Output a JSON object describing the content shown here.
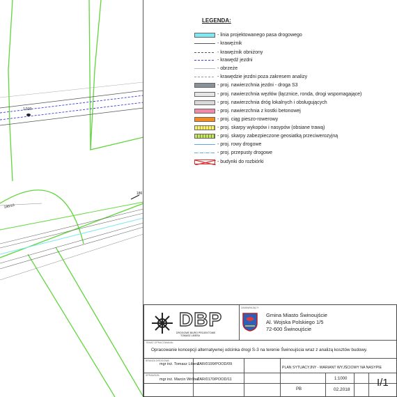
{
  "drawing": {
    "scale_label": "1:500",
    "label_a": "186/10",
    "label_b": "186"
  },
  "legend": {
    "title": "LEGENDA:",
    "items": [
      {
        "label": "- linia projektowanego pasa drogowego",
        "icon": "cyan-fill",
        "color": "#7fe8f2"
      },
      {
        "label": "- krawężnik",
        "icon": "solid-line",
        "color": "#555555"
      },
      {
        "label": "- krawężnik obniżony",
        "icon": "dashed-line",
        "color": "#555555"
      },
      {
        "label": "- krawędź jezdni",
        "icon": "blue-dashed-line",
        "color": "#3b3bd6"
      },
      {
        "label": "- obrzeże",
        "icon": "thin-line",
        "color": "#777777"
      },
      {
        "label": "- krawędzie jezdni poza zakresem analizy",
        "icon": "gray-dashed-line",
        "color": "#999999"
      },
      {
        "label": "- proj. nawierzchnia jezdni - droga S3",
        "icon": "gray-fill",
        "color": "#8a9198"
      },
      {
        "label": "- proj. nawierzchnia węzłów (łącznice, ronda, drogi wspomagające)",
        "icon": "lightgray-fill",
        "color": "#e6e6e6"
      },
      {
        "label": "- proj. nawierzchnia dróg lokalnych i obsługujących",
        "icon": "lightgray-fill-2",
        "color": "#d9d9d9"
      },
      {
        "label": "- proj. nawierzchnia z kostki betonowej",
        "icon": "pink-fill",
        "color": "#f08aa8"
      },
      {
        "label": "- proj. ciąg pieszo-rowerowy",
        "icon": "orange-fill",
        "color": "#f58a1f"
      },
      {
        "label": "- proj. skarpy wykopów i nasypów (obsiane trawą)",
        "icon": "yellow-hatch",
        "color": "#f3ef86"
      },
      {
        "label": "- proj. skarpy zabezpieczone geosiatką przeciwerozyjną",
        "icon": "green-yellow-hatch",
        "color": "#c9e26a"
      },
      {
        "label": "- proj. rowy drogowe",
        "icon": "ditch-line",
        "color": "#5aa9e6"
      },
      {
        "label": "- proj. przepusty drogowe",
        "icon": "culvert-line",
        "color": "#5aa9e6"
      },
      {
        "label": "- budynki do rozbiórki",
        "icon": "red-cross-box",
        "color": "#e03030"
      }
    ]
  },
  "titleblock": {
    "logo_text": "DBP",
    "logo_caption": "DROGOWE BIURO PROJEKTOWE\nTOMASZ LIBERA",
    "client_header": "ZAMAWIAJĄCY:",
    "client_name": "Gmina Miasto Świnoujście",
    "client_address": "Al. Wojska Polskiego 1/5",
    "client_city": "72-600 Świnoujście",
    "study_header": "TEMAT OPRACOWANIA:",
    "study_title": "Opracowanie koncepcji alternatywnej odcinka drogi S-3 na terenie Świnoujścia wraz z analizą kosztów budowy.",
    "role1_header": "BRANŻA DROGOWA",
    "role1_name": "mgr inż. Tomasz Libera",
    "role1_number": "ZAR/0199/POOD/09",
    "role2_header": "SPRAWDZIŁ",
    "role2_name": "mgr inż. Marcin Wróbel",
    "role2_number": "ZAR/0170/POOD/11",
    "sheet_title": "PLAN SYTUACYJNY - WARIANT WYJŚCIOWY NA NASYPIE",
    "stage": "PB",
    "scale": "1:1000",
    "date": "02.2018",
    "sheet_no": "I/1"
  }
}
